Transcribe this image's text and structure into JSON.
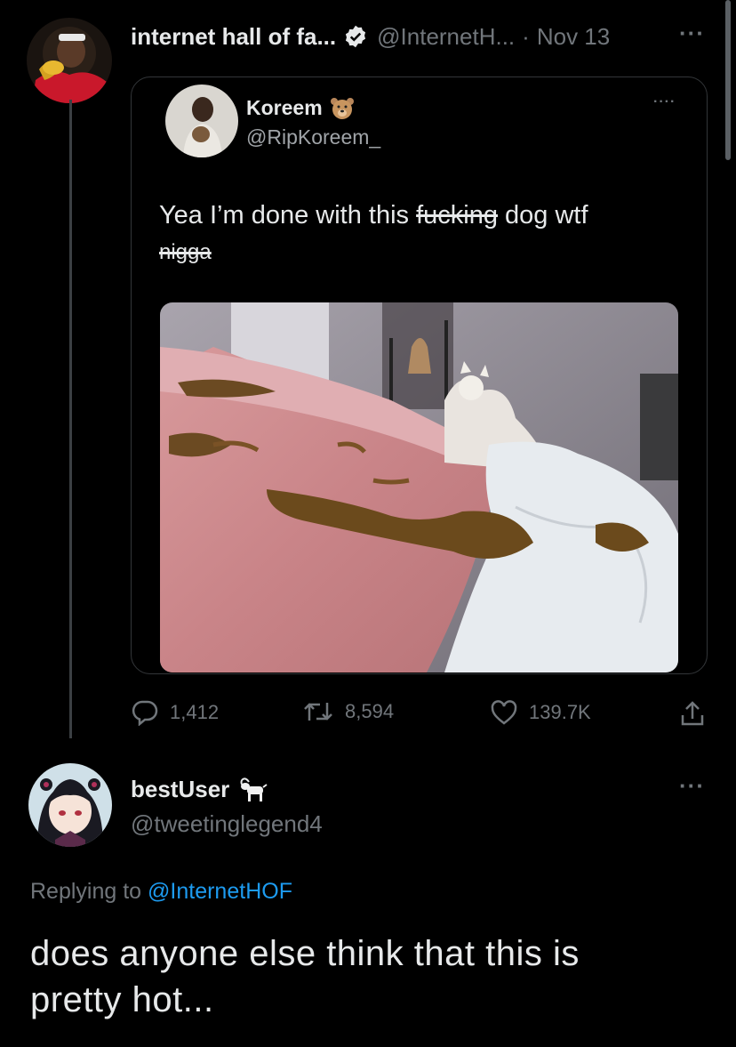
{
  "main_tweet": {
    "display_name": "internet hall of fa...",
    "handle": "@InternetH...",
    "separator": "·",
    "date": "Nov 13",
    "more": "···",
    "verified_icon": "verified-badge-icon",
    "quoted_tweet": {
      "display_name": "Koreem",
      "emoji_icon": "bear-face-icon",
      "handle": "@RipKoreem_",
      "more": "····",
      "text_1": "Yea I’m done with this ",
      "text_struck_1": "fucking",
      "text_2": " dog wtf",
      "text_struck_2": "nigga"
    },
    "actions": {
      "replies": "1,412",
      "retweets": "8,594",
      "likes": "139.7K"
    }
  },
  "reply": {
    "display_name": "bestUser",
    "emoji_icon": "goat-icon",
    "handle": "@tweetinglegend4",
    "more": "···",
    "replying_prefix": "Replying to",
    "replying_handle": "@InternetHOF",
    "text": "does anyone else think that this is pretty hot..."
  },
  "colors": {
    "background": "#000000",
    "text": "#e7e9ea",
    "muted": "#71767b",
    "link": "#1d9bf0",
    "border": "#333639"
  }
}
